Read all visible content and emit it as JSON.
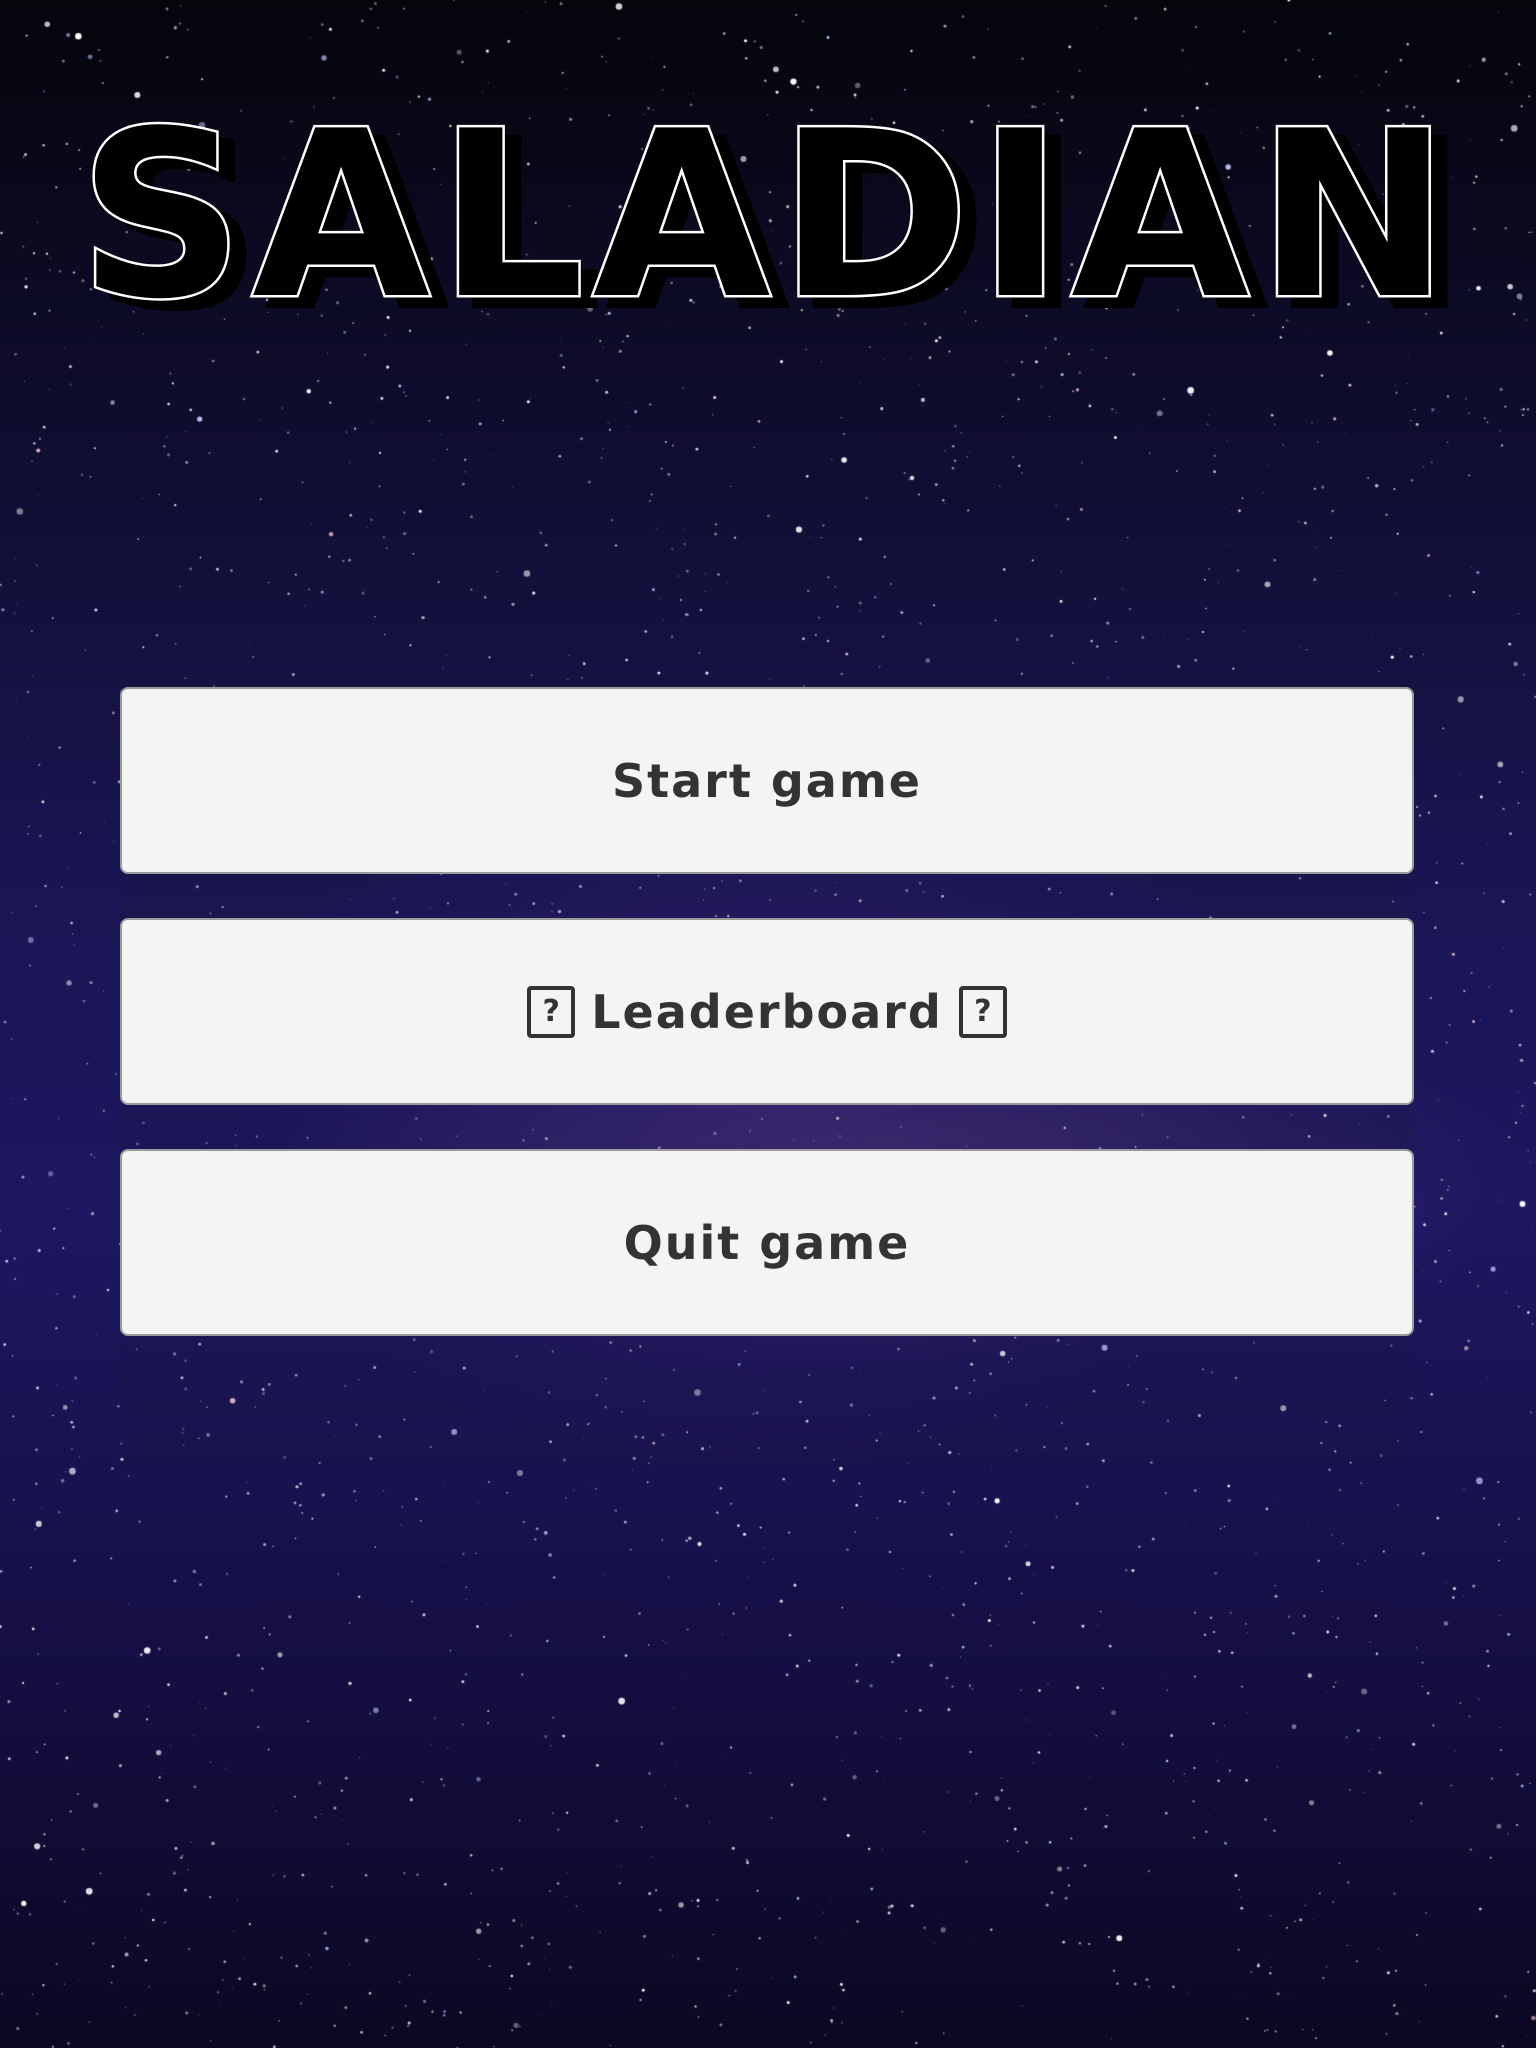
{
  "game": {
    "title": "SALADIAN"
  },
  "menu": {
    "start_label": "Start game",
    "leaderboard_label": "Leaderboard",
    "leaderboard_icon_glyph": "?",
    "quit_label": "Quit game"
  },
  "icons": {
    "leaderboard_left": "missing-glyph-icon",
    "leaderboard_right": "missing-glyph-icon"
  },
  "colors": {
    "background_top": "#05050c",
    "background_mid": "#1d1760",
    "button_fill": "#f4f4f4",
    "button_text": "#333333",
    "title_fill": "#000000",
    "title_outline": "#ffffff"
  }
}
